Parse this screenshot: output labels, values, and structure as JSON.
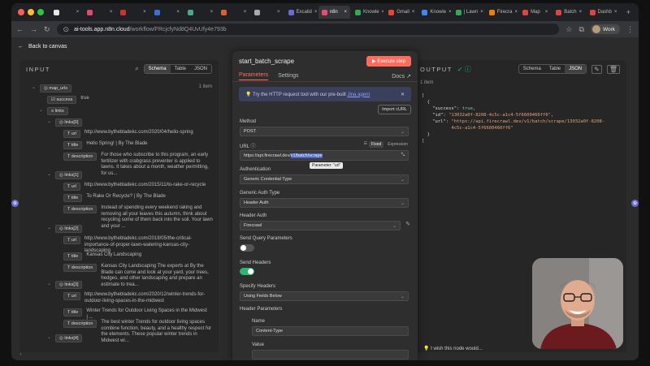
{
  "browser": {
    "tabs": [
      {
        "label": "",
        "color": "#e8e8e8"
      },
      {
        "label": "",
        "color": "#e04b6a"
      },
      {
        "label": "",
        "color": "#c33"
      },
      {
        "label": "",
        "color": "#3a6fd8"
      },
      {
        "label": "",
        "color": "#4a8"
      },
      {
        "label": "",
        "color": "#e05d30"
      },
      {
        "label": "",
        "color": "#aaa"
      },
      {
        "label": "Excalid",
        "color": "#6a6bd5"
      },
      {
        "label": "n8n",
        "color": "#ea4b71"
      },
      {
        "label": "Knowle",
        "color": "#34a853"
      },
      {
        "label": "Gmail",
        "color": "#ea4335"
      },
      {
        "label": "Knowle",
        "color": "#4285f4"
      },
      {
        "label": "| Lawn",
        "color": "#34a853"
      },
      {
        "label": "Firecra",
        "color": "#f57c00"
      },
      {
        "label": "Map",
        "color": "#d44"
      },
      {
        "label": "Batch",
        "color": "#d44"
      },
      {
        "label": "Dashb",
        "color": "#d44"
      }
    ],
    "url_host": "ai-tools.app.n8n.cloud",
    "url_path": "/workflow/FRcjcfyNd8Q4UvUfy4e793b",
    "profile": "Work"
  },
  "canvas": {
    "back_label": "Back to canvas"
  },
  "input_panel": {
    "title": "INPUT",
    "views": [
      "Schema",
      "Table",
      "JSON"
    ],
    "root_key": "map_urls",
    "item_count": "1 item",
    "success_key": "success",
    "success_val": "true",
    "links_key": "links",
    "url_key": "url",
    "title_key": "title",
    "desc_key": "description",
    "items": [
      {
        "key": "links[0]",
        "url": "http://www.bythebladekc.com/2020/04/hello-spring",
        "title": "Hello Spring! | By The Blade",
        "desc": "For those who subscribe to this program, an early fertilizer with crabgrass preventer is applied to lawns. It takes about a month, weather permitting, for us..."
      },
      {
        "key": "links[1]",
        "url": "http://www.bythebladekc.com/2015/11/to-rake-or-recycle",
        "title": "To Rake Or Recycle? | By The Blade",
        "desc": "Instead of spending every weekend raking and removing all your leaves this autumn, think about recycling some of them back into the soil. Your lawn and your ..."
      },
      {
        "key": "links[2]",
        "url": "http://www.bythebladekc.com/2019/05/the-critical-importance-of-proper-lawn-watering-kansas-city-landscaping",
        "title": "Kansas City Landscaping",
        "desc": "Kansas City Landscaping The experts at By the Blade can come and look at your yard, your trees, hedges, and other landscaping and prepare an estimate to trea..."
      },
      {
        "key": "links[3]",
        "url": "http://www.bythebladekc.com/2020/12/winter-trends-for-outdoor-living-spaces-in-the-midwest",
        "title": "Winter Trends for Outdoor Living Spaces in the Midwest | ...",
        "desc": "The best winter Trends for outdoor living spaces combine function, beauty, and a healthy respect for the elements. These popular winter trends in Midwest wi..."
      },
      {
        "key": "links[4]",
        "url": "",
        "title": "",
        "desc": ""
      }
    ]
  },
  "node": {
    "name": "start_batch_scrape",
    "execute_label": "Execute step",
    "tabs": [
      "Parameters",
      "Settings"
    ],
    "docs_label": "Docs",
    "banner_text": "Try the HTTP request tool with our pre-built",
    "banner_link": "Jina agent",
    "import_label": "Import cURL",
    "method_label": "Method",
    "method_value": "POST",
    "url_label": "URL",
    "fixed_label": "Fixed",
    "expression_label": "Expression",
    "url_prefix": "https://api.firecrawl.dev/",
    "url_sel": "v1/batch/scrape",
    "tooltip": "Parameter: \"url\"",
    "auth_label": "Authentication",
    "auth_value": "Generic Credential Type",
    "gauth_label": "Generic Auth Type",
    "gauth_value": "Header Auth",
    "hauth_label": "Header Auth",
    "hauth_value": "Firecrawl",
    "query_label": "Send Query Parameters",
    "query_on": false,
    "headers_label": "Send Headers",
    "headers_on": true,
    "spec_label": "Specify Headers",
    "spec_value": "Using Fields Below",
    "hparams_label": "Header Parameters",
    "name_label": "Name",
    "name_value": "Content-Type",
    "value_label": "Value"
  },
  "output_panel": {
    "title": "OUTPUT",
    "views": [
      "Schema",
      "Table",
      "JSON"
    ],
    "item_count": "1 item",
    "json": {
      "success": "true",
      "id": "\"13032a0f-8208-4c5c-a1c4-5f6600460ff6\"",
      "url": "\"https://api.firecrawl.dev/v1/batch/scrape/13032a0f-8208-4c5c-a1c4-5f6600460ff6\""
    },
    "wish_text": "I wish this node would..."
  }
}
